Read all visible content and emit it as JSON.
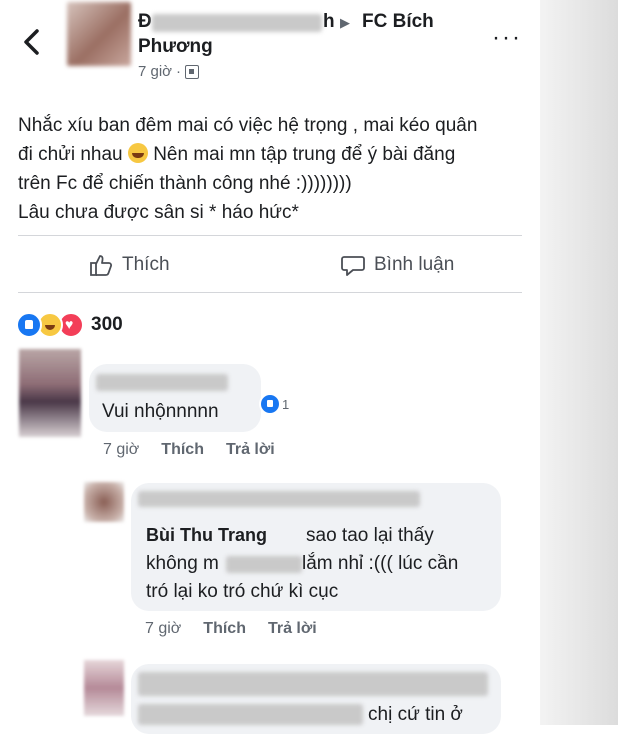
{
  "header": {
    "name_start": "Đ",
    "name_end": "h",
    "group": "FC Bích",
    "name_line2": "Phương",
    "time": "7 giờ",
    "separator": "·",
    "more": "···"
  },
  "post": {
    "lines": [
      "Nhắc xíu ban đêm mai có việc hệ trọng , mai kéo quân",
      "đi chửi nhau",
      "Nên mai mn tập trung để ý bài đăng",
      "trên Fc để chiến thành công nhé :))))))))",
      "Lâu chưa được sân si  * háo hức*"
    ],
    "emoji": "laughing-emoji"
  },
  "actions": {
    "like": "Thích",
    "comment": "Bình luận"
  },
  "reactions": {
    "types": [
      "like",
      "haha",
      "love"
    ],
    "count": "300"
  },
  "comments": [
    {
      "text": "Vui nhộnnnnn",
      "reaction_count": "1",
      "time": "7 giờ",
      "like": "Thích",
      "reply": "Trả lời"
    },
    {
      "author": "Bùi Thu Trang",
      "text_line1": "sao tao lại thấy",
      "text_line2a": "không m",
      "text_line2b": "lắm nhỉ :((( lúc cần",
      "text_line3": "tró lại ko tró chứ kì cục",
      "time": "7 giờ",
      "like": "Thích",
      "reply": "Trả lời"
    },
    {
      "text_visible": "chị cứ tin ở"
    }
  ],
  "colors": {
    "like_blue": "#1877f2",
    "bubble": "#f0f2f5",
    "meta_gray": "#606770"
  }
}
